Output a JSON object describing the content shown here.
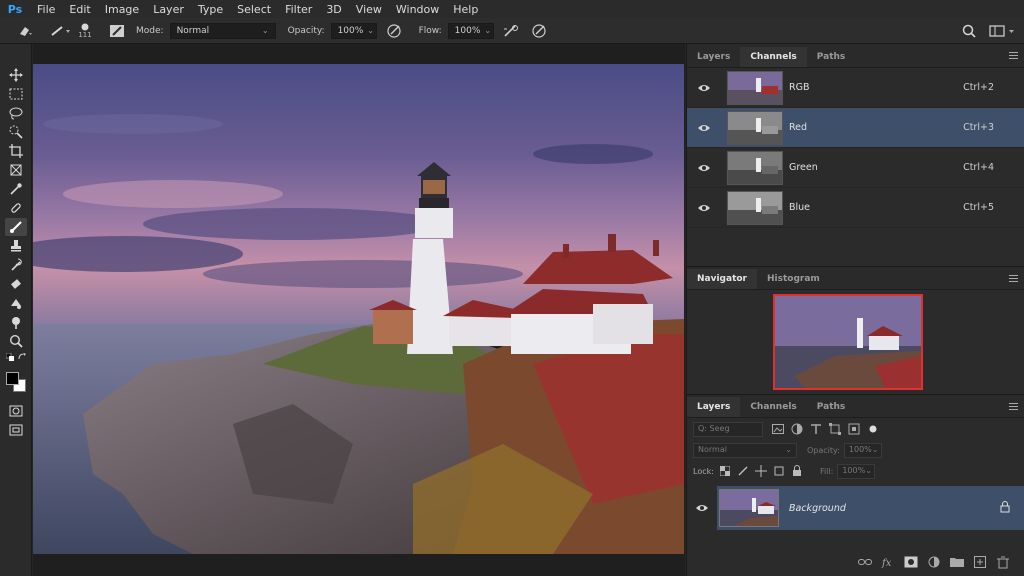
{
  "app": {
    "logo": "Ps"
  },
  "menu": [
    "File",
    "Edit",
    "Image",
    "Layer",
    "Type",
    "Select",
    "Filter",
    "3D",
    "View",
    "Window",
    "Help"
  ],
  "options": {
    "mode_label": "Mode:",
    "mode_value": "Normal",
    "opacity_label": "Opacity:",
    "opacity_value": "100%",
    "flow_label": "Flow:",
    "flow_value": "100%",
    "brush_size": "111"
  },
  "tools": [
    "move-tool",
    "marquee-tool",
    "lasso-tool",
    "quick-select-tool",
    "crop-tool",
    "eyedropper-tool",
    "healing-brush-tool",
    "brush-tool",
    "clone-stamp-tool",
    "history-brush-tool",
    "eraser-tool",
    "gradient-tool",
    "dodge-tool",
    "zoom-tool"
  ],
  "colors": {
    "foreground": "#000000",
    "background": "#ffffff",
    "selection": "#3d4f69",
    "accent": "#31a8ff"
  },
  "channels_panel": {
    "tabs": [
      "Layers",
      "Channels",
      "Paths"
    ],
    "active_tab": "Channels",
    "rows": [
      {
        "name": "RGB",
        "shortcut": "Ctrl+2",
        "selected": false,
        "thumb": "color"
      },
      {
        "name": "Red",
        "shortcut": "Ctrl+3",
        "selected": true,
        "thumb": "gray"
      },
      {
        "name": "Green",
        "shortcut": "Ctrl+4",
        "selected": false,
        "thumb": "gray"
      },
      {
        "name": "Blue",
        "shortcut": "Ctrl+5",
        "selected": false,
        "thumb": "gray"
      }
    ]
  },
  "navigator_panel": {
    "tabs": [
      "Navigator",
      "Histogram"
    ],
    "active_tab": "Navigator"
  },
  "layers_panel": {
    "tabs": [
      "Layers",
      "Channels",
      "Paths"
    ],
    "active_tab": "Layers",
    "filter_placeholder": "Q: Seeg",
    "blend_mode": "Normal",
    "opacity_label": "Opacity:",
    "opacity_value": "100%",
    "lock_label": "Lock:",
    "fill_label": "Fill:",
    "fill_value": "100%",
    "layers": [
      {
        "name": "Background",
        "locked": true,
        "visible": true
      }
    ]
  }
}
